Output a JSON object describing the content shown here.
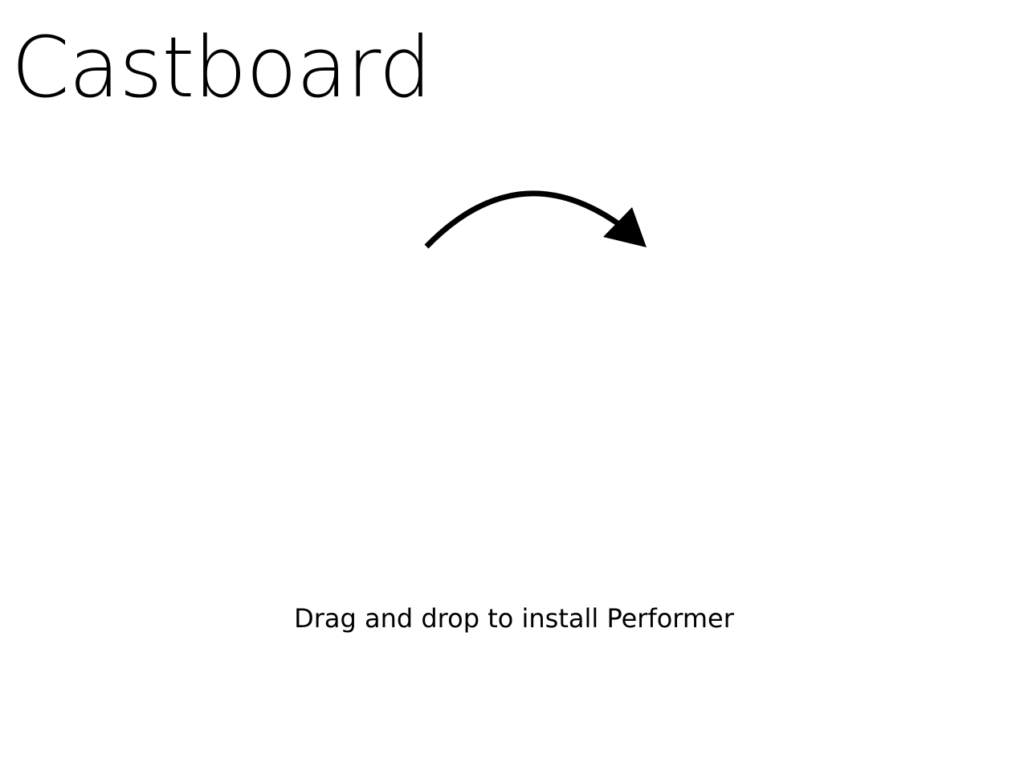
{
  "window": {
    "title": "Castboard"
  },
  "installer": {
    "arrow_icon": "curved-arrow-right-icon",
    "instruction": "Drag and drop to install Performer"
  },
  "colors": {
    "background": "#ffffff",
    "foreground": "#000000"
  }
}
